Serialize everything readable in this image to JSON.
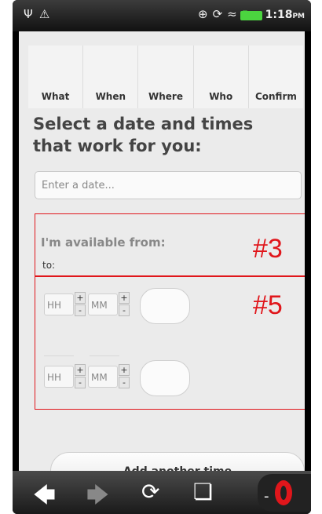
{
  "status_bar": {
    "time": "1:18",
    "ampm": "PM",
    "left_icons": [
      "usb-icon",
      "warning-icon"
    ],
    "right_icons": [
      "gps-icon",
      "sync-icon",
      "wifi-icon",
      "signal-icon",
      "battery-icon"
    ]
  },
  "tabs": [
    {
      "label": "What"
    },
    {
      "label": "When"
    },
    {
      "label": "Where"
    },
    {
      "label": "Who"
    },
    {
      "label": "Confirm"
    }
  ],
  "heading": "Select a date and times that work for you:",
  "date_input": {
    "placeholder": "Enter a date...",
    "value": ""
  },
  "availability": {
    "from_label": "I'm available from:",
    "to_label": "to:"
  },
  "time_rows": [
    {
      "hour_placeholder": "HH",
      "minute_placeholder": "MM",
      "plus": "+",
      "minus": "-"
    },
    {
      "hour_placeholder": "HH",
      "minute_placeholder": "MM",
      "plus": "+",
      "minus": "-"
    }
  ],
  "add_button": {
    "label": "Add another time"
  },
  "annotations": [
    {
      "label": "#3",
      "color": "#e0161b"
    },
    {
      "label": "#5",
      "color": "#e0161b"
    }
  ],
  "nav_bar": {
    "icons": [
      "back-icon",
      "forward-icon",
      "refresh-icon",
      "tabs-icon",
      "opera-icon"
    ]
  }
}
